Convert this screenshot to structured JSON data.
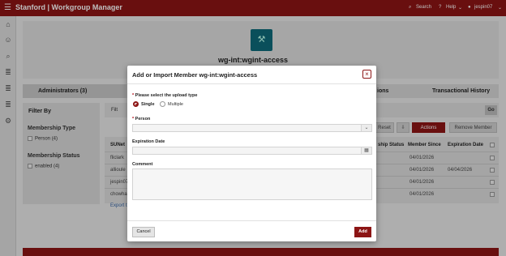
{
  "header": {
    "title": "Stanford | Workgroup Manager",
    "search_label": "Search",
    "help_label": "Help",
    "user_label": "jespin07"
  },
  "sidebar": {
    "icons": [
      "home-icon",
      "people-icon",
      "search-icon",
      "list-icon",
      "list-icon",
      "list-icon",
      "gear-icon"
    ]
  },
  "page": {
    "workgroup_name": "wg-int:wgint-access",
    "tabs": [
      "Administrators (3)",
      "ions",
      "Transactional History"
    ],
    "filter": {
      "title": "Filter By",
      "group1_title": "Membership Type",
      "group1_option": "Person",
      "group1_count": "(4)",
      "group2_title": "Membership Status",
      "group2_option": "enabled",
      "group2_count": "(4)"
    },
    "search_placeholder": "Filt",
    "go_label": "Go",
    "toolbar": {
      "reset_label": "Reset",
      "actions_label": "Actions",
      "remove_label": "Remove Member"
    },
    "table": {
      "headers": [
        "SUNet",
        "ship Status",
        "Member Since",
        "Expiration Date"
      ],
      "rows": [
        {
          "sunet": "fliclark",
          "since": "04/01/2026",
          "expiration": ""
        },
        {
          "sunet": "allioule",
          "since": "04/01/2026",
          "expiration": "04/04/2026"
        },
        {
          "sunet": "jespin07",
          "since": "04/01/2026",
          "expiration": ""
        },
        {
          "sunet": "chowhar",
          "since": "04/01/2026",
          "expiration": ""
        }
      ],
      "export_label": "Export t"
    }
  },
  "modal": {
    "title": "Add or Import Member wg-int:wgint-access",
    "upload_type_label": "Please select the upload type",
    "option_single": "Single",
    "option_multiple": "Multiple",
    "selected_option": "Single",
    "person_label": "Person",
    "person_value": "",
    "expiration_label": "Expiration Date",
    "expiration_value": "",
    "comment_label": "Comment",
    "comment_value": "",
    "cancel_label": "Cancel",
    "add_label": "Add"
  },
  "colors": {
    "brand": "#8c1515",
    "app_tile": "#0e6a7a"
  }
}
